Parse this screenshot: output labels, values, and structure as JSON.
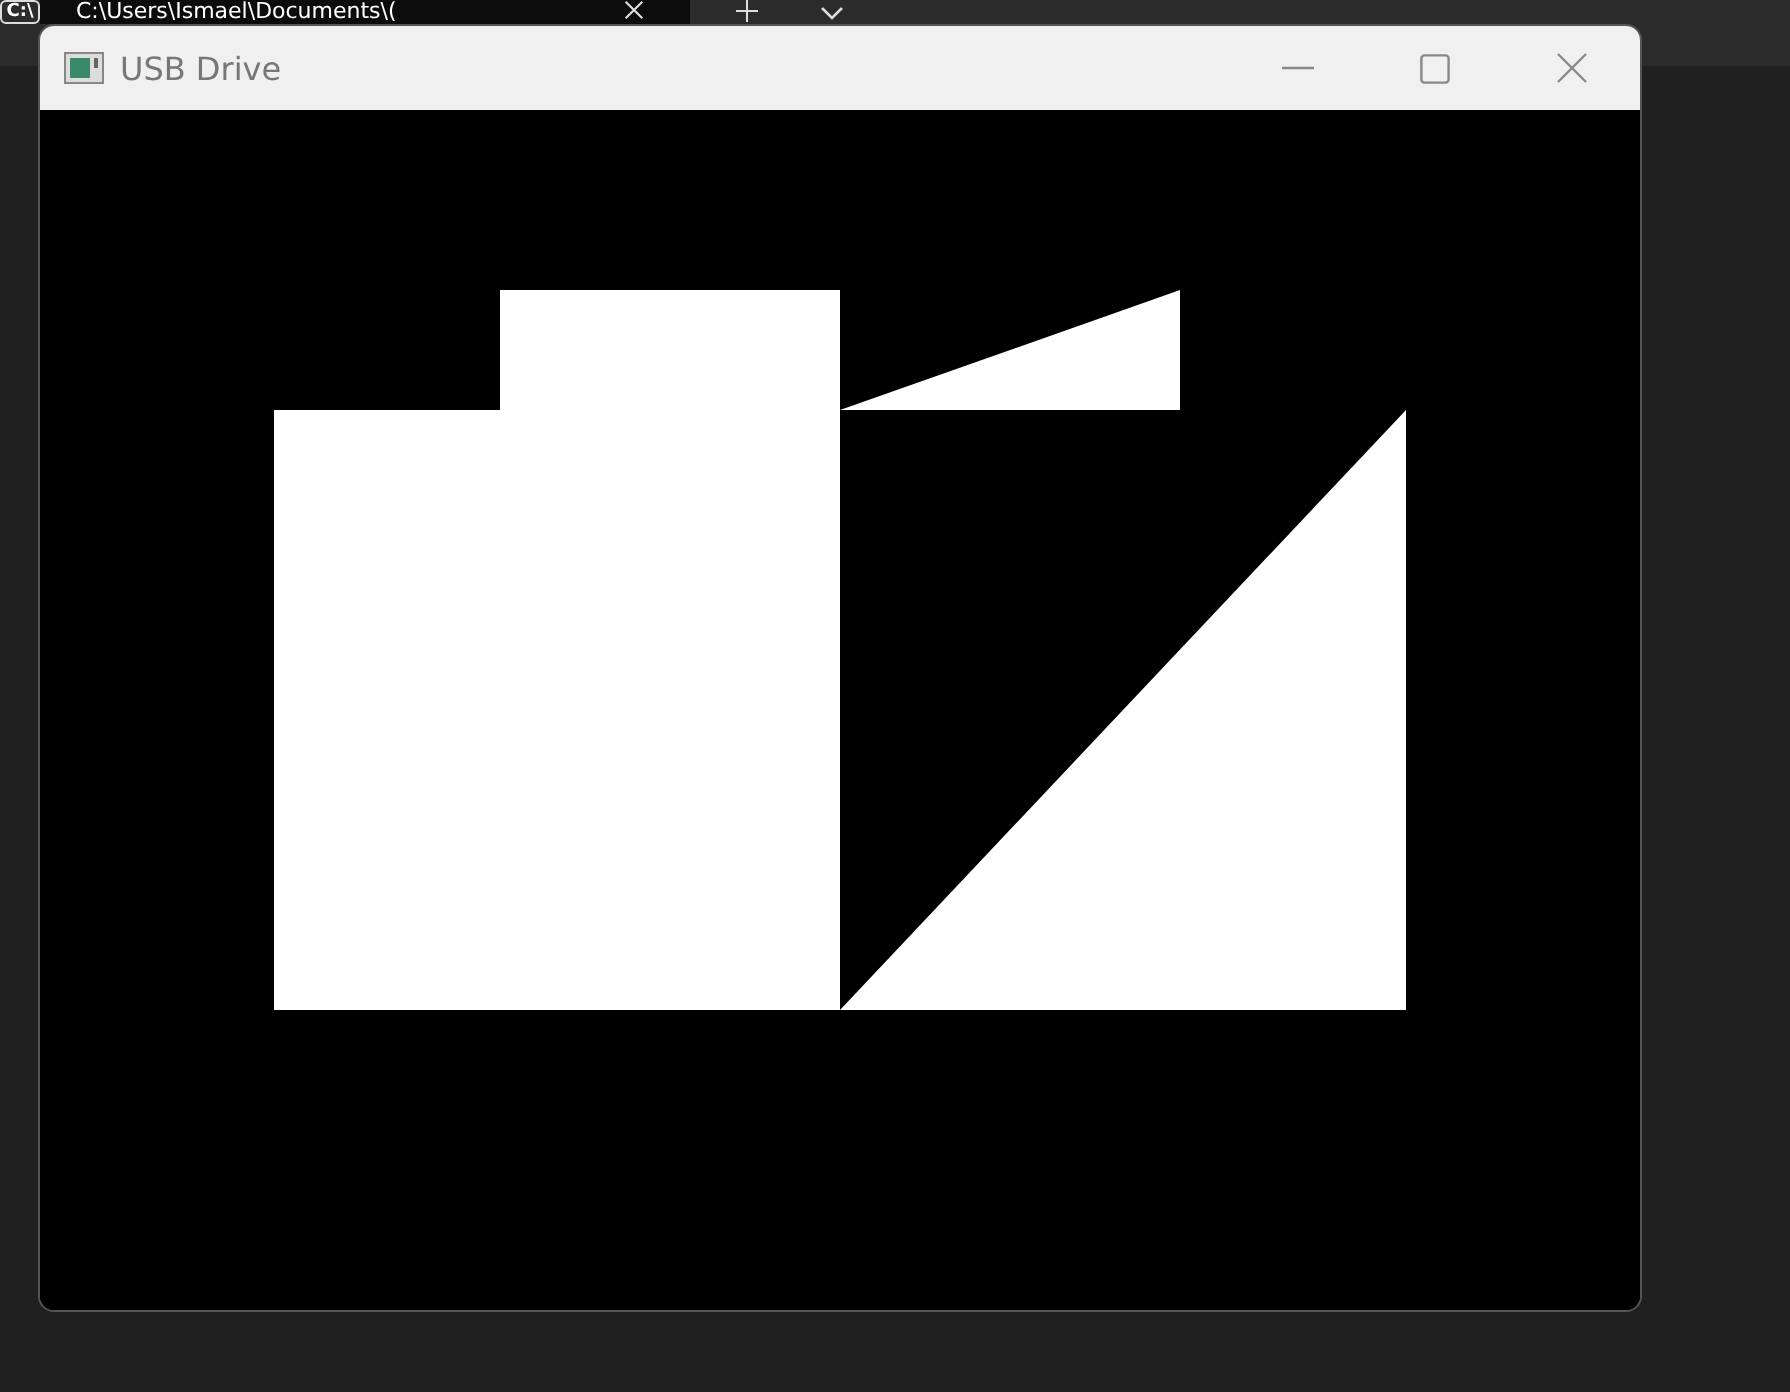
{
  "terminal": {
    "icon_text": "C:\\",
    "tab_title": "C:\\Users\\Ismael\\Documents\\("
  },
  "window": {
    "title": "USB Drive"
  }
}
